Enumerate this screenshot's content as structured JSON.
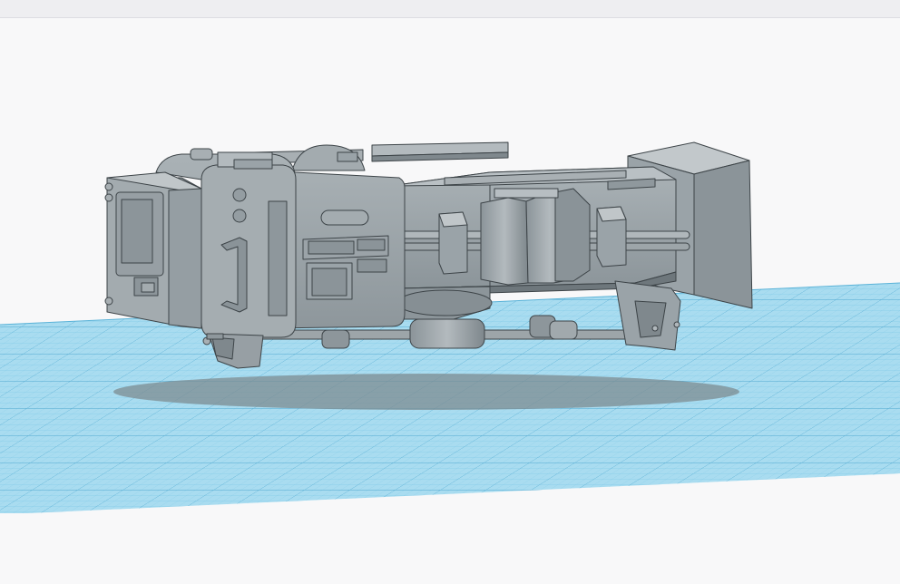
{
  "app": {
    "view": "3d-workplane",
    "workplane": {
      "color": "#a9dcf0",
      "grid_color": "#6fbfe0",
      "grid_major_color": "#4ea8d0",
      "snap_to_grid": true
    },
    "model": {
      "color": "#9aa3a8",
      "shade_dark": "#6e777c",
      "shade_light": "#b9c0c4",
      "edge_color": "#3d4448",
      "shadow_color": "#7c8588"
    }
  }
}
